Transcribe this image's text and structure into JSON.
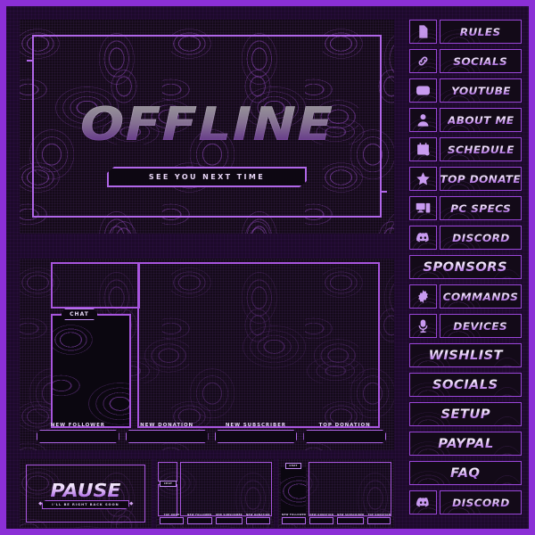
{
  "theme": {
    "accent": "#a855de",
    "accent_bright": "#b066e8",
    "frame_border": "#8b2fd6",
    "background": "#1d0a2b",
    "panel_dark": "#140a18",
    "text_light": "#e8d6f7"
  },
  "offline_screen": {
    "title": "OFFLINE",
    "subtitle": "SEE YOU NEXT TIME"
  },
  "stream_overlay": {
    "chat_tab_label": "CHAT",
    "alerts": [
      {
        "label": "NEW FOLLOWER",
        "value": ""
      },
      {
        "label": "NEW DONATION",
        "value": ""
      },
      {
        "label": "NEW SUBSCRIBER",
        "value": ""
      },
      {
        "label": "TOP DONATION",
        "value": ""
      }
    ]
  },
  "pause_screen": {
    "title": "PAUSE",
    "subtitle": "I'LL BE RIGHT BACK SOON"
  },
  "overlay_variants": [
    {
      "name": "variant-a",
      "chat_tab_label": "CHAT",
      "alerts": [
        {
          "label": "TOP DONO"
        },
        {
          "label": "NEW FOLLOWER"
        },
        {
          "label": "NEW SUBSCRIBER"
        },
        {
          "label": "NEW DONATION"
        }
      ]
    },
    {
      "name": "variant-b",
      "chat_tab_label": "CHAT",
      "alerts": [
        {
          "label": "NEW FOLLOWER"
        },
        {
          "label": "NEW DONATION"
        },
        {
          "label": "NEW SUBSCRIBER"
        },
        {
          "label": "TOP DONATION"
        }
      ]
    }
  ],
  "sidebar": {
    "items": [
      {
        "label": "RULES",
        "icon": "document-icon",
        "has_icon": true
      },
      {
        "label": "SOCIALS",
        "icon": "link-icon",
        "has_icon": true
      },
      {
        "label": "YOUTUBE",
        "icon": "play-icon",
        "has_icon": true
      },
      {
        "label": "ABOUT ME",
        "icon": "person-icon",
        "has_icon": true
      },
      {
        "label": "SCHEDULE",
        "icon": "calendar-icon",
        "has_icon": true
      },
      {
        "label": "TOP DONATE",
        "icon": "star-icon",
        "has_icon": true
      },
      {
        "label": "PC SPECS",
        "icon": "monitor-icon",
        "has_icon": true
      },
      {
        "label": "DISCORD",
        "icon": "discord-icon",
        "has_icon": true
      },
      {
        "label": "SPONSORS",
        "icon": "",
        "has_icon": false
      },
      {
        "label": "COMMANDS",
        "icon": "gear-icon",
        "has_icon": true
      },
      {
        "label": "DEVICES",
        "icon": "microphone-icon",
        "has_icon": true
      },
      {
        "label": "WISHLIST",
        "icon": "",
        "has_icon": false
      },
      {
        "label": "SOCIALS",
        "icon": "",
        "has_icon": false
      },
      {
        "label": "SETUP",
        "icon": "",
        "has_icon": false
      },
      {
        "label": "PAYPAL",
        "icon": "",
        "has_icon": false
      },
      {
        "label": "FAQ",
        "icon": "",
        "has_icon": false
      },
      {
        "label": "DISCORD",
        "icon": "discord-icon",
        "has_icon": true
      }
    ]
  }
}
